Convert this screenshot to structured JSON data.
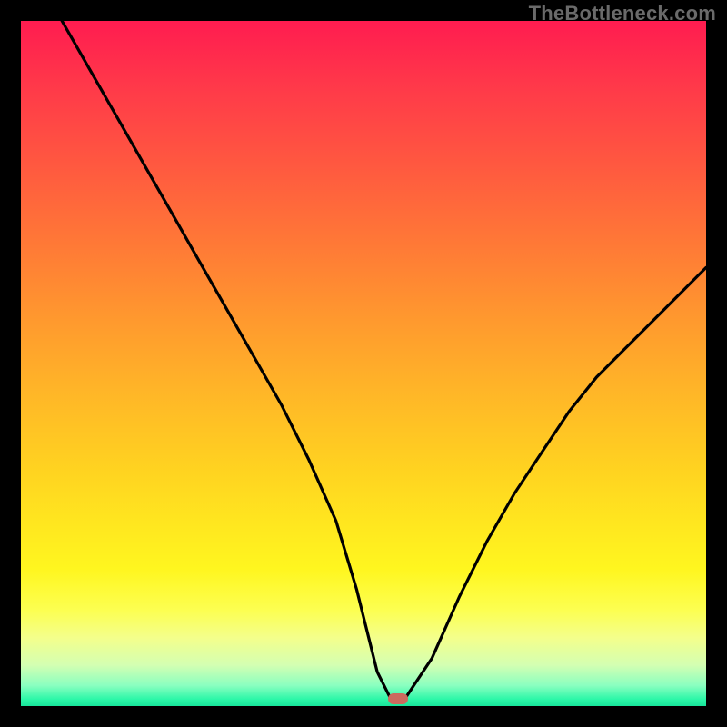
{
  "watermark": "TheBottleneck.com",
  "colors": {
    "background": "#000000",
    "curve": "#000000",
    "marker": "#cc6a5e"
  },
  "chart_data": {
    "type": "line",
    "title": "",
    "xlabel": "",
    "ylabel": "",
    "xlim": [
      0,
      100
    ],
    "ylim": [
      0,
      100
    ],
    "grid": false,
    "series": [
      {
        "name": "bottleneck-curve",
        "x": [
          6,
          10,
          14,
          18,
          22,
          26,
          30,
          34,
          38,
          42,
          46,
          49,
          52,
          54,
          56,
          60,
          64,
          68,
          72,
          76,
          80,
          84,
          88,
          92,
          96,
          100
        ],
        "values": [
          100,
          93,
          86,
          79,
          72,
          65,
          58,
          51,
          44,
          36,
          27,
          17,
          5,
          1,
          1,
          7,
          16,
          24,
          31,
          37,
          43,
          48,
          52,
          56,
          60,
          64
        ]
      }
    ],
    "marker": {
      "x": 55,
      "y": 1
    },
    "background_gradient": {
      "top": "#ff1c50",
      "bottom": "#18e59b"
    }
  }
}
